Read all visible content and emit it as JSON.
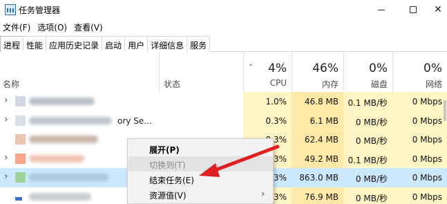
{
  "window": {
    "title": "任务管理器",
    "minimize_glyph": "—",
    "close_glyph": "✕"
  },
  "menu": [
    "文件(F)",
    "选项(O)",
    "查看(V)"
  ],
  "tabs": [
    "进程",
    "性能",
    "应用历史记录",
    "启动",
    "用户",
    "详细信息",
    "服务"
  ],
  "active_tab": "进程",
  "header": {
    "name": "名称",
    "status": "状态",
    "sort_glyph": "⌄",
    "cpu": {
      "pct": "4%",
      "label": "CPU"
    },
    "memory": {
      "pct": "46%",
      "label": "内存"
    },
    "disk": {
      "pct": "0%",
      "label": "磁盘"
    },
    "network": {
      "pct": "0%",
      "label": "网络"
    }
  },
  "rows": [
    {
      "name": "",
      "cpu": "1.0%",
      "mem": "46.8 MB",
      "disk": "0.1 MB/秒",
      "net": "0 Mbps",
      "icon_color": "#cfd8e3",
      "blur_color": "#b9c0c8"
    },
    {
      "name": "ory Se...",
      "cpu": "0.3%",
      "mem": "6.1 MB",
      "disk": "0 MB/秒",
      "net": "0 Mbps",
      "icon_color": "#d7dfe8",
      "blur_color": "#bfc6ce"
    },
    {
      "name": "",
      "cpu": "0.3%",
      "mem": "62.4 MB",
      "disk": "0 MB/秒",
      "net": "0 Mbps",
      "icon_color": "#e9c6b2",
      "blur_color": "#c9b6ab"
    },
    {
      "name": "",
      "cpu": "0.3%",
      "mem": "49.2 MB",
      "disk": "0.1 MB/秒",
      "net": "0 Mbps",
      "icon_color": "#f4a78a",
      "blur_color": "#f0c4b3"
    },
    {
      "name": "",
      "cpu": "0.3%",
      "mem": "863.0 MB",
      "disk": "0 MB/秒",
      "net": "0 Mbps",
      "icon_color": "#9fd39a",
      "blur_color": "#a9c8d9"
    },
    {
      "name": "",
      "cpu": "0.3%",
      "mem": "76.9 MB",
      "disk": "0 MB/秒",
      "net": "0 Mbps",
      "icon_color": "#3d6fc8",
      "blur_color": "#c8cdd3"
    }
  ],
  "expand_glyph": "›",
  "context_menu": {
    "items": [
      "展开(P)",
      "切换到(T)",
      "结束任务(E)",
      "资源值(V)"
    ],
    "submenu_glyph": "›"
  },
  "colors": {
    "accent_arrow": "#e02020",
    "selection": "#cce8ff",
    "heat_light": "#fff4c4",
    "heat_medium": "#ffe9a8"
  }
}
